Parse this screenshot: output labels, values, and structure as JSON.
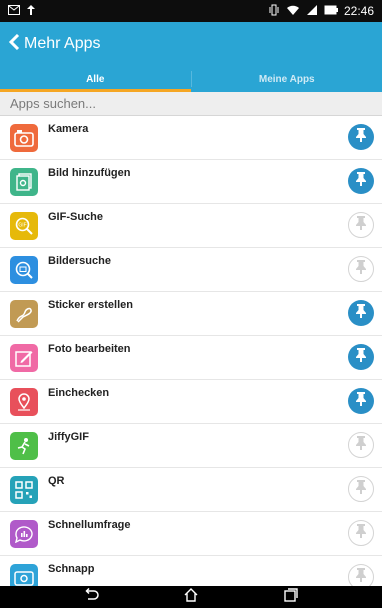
{
  "status_bar": {
    "time": "22:46"
  },
  "header": {
    "title": "Mehr Apps"
  },
  "tabs": [
    {
      "label": "Alle",
      "active": true
    },
    {
      "label": "Meine Apps",
      "active": false
    }
  ],
  "search": {
    "placeholder": "Apps suchen..."
  },
  "apps": [
    {
      "label": "Kamera",
      "icon": "camera-icon",
      "color": "#ef6a3c",
      "pinned": true
    },
    {
      "label": "Bild hinzufügen",
      "icon": "add-image-icon",
      "color": "#3fb58a",
      "pinned": true
    },
    {
      "label": "GIF-Suche",
      "icon": "gif-search-icon",
      "color": "#e6b90a",
      "pinned": false
    },
    {
      "label": "Bildersuche",
      "icon": "image-search-icon",
      "color": "#2d8fe0",
      "pinned": false
    },
    {
      "label": "Sticker erstellen",
      "icon": "sticker-icon",
      "color": "#c19a54",
      "pinned": true
    },
    {
      "label": "Foto bearbeiten",
      "icon": "edit-photo-icon",
      "color": "#f06aa5",
      "pinned": true
    },
    {
      "label": "Einchecken",
      "icon": "location-pin-icon",
      "color": "#e8505b",
      "pinned": true
    },
    {
      "label": "JiffyGIF",
      "icon": "jiffygif-icon",
      "color": "#4fbf48",
      "pinned": false
    },
    {
      "label": "QR",
      "icon": "qr-code-icon",
      "color": "#26a2b8",
      "pinned": false
    },
    {
      "label": "Schnellumfrage",
      "icon": "poll-icon",
      "color": "#b05ac9",
      "pinned": false
    },
    {
      "label": "Schnapp",
      "icon": "snap-icon",
      "color": "#2ea3d8",
      "pinned": false
    }
  ],
  "colors": {
    "header": "#2aa5d4",
    "tab_indicator": "#f5a623",
    "pin_active": "#2a8fc6"
  }
}
